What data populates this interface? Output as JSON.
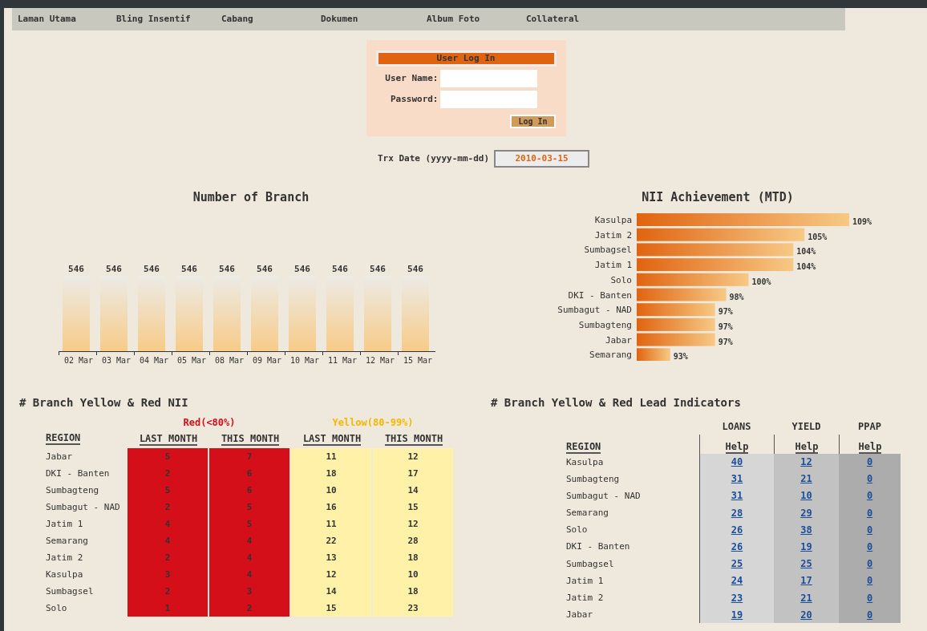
{
  "nav": [
    {
      "label": "Laman Utama"
    },
    {
      "label": "Bling Insentif"
    },
    {
      "label": "Cabang"
    },
    {
      "label": "Dokumen"
    },
    {
      "label": "Album Foto"
    },
    {
      "label": "Collateral"
    }
  ],
  "login": {
    "title": "User Log In",
    "fields": [
      {
        "label": "User Name:"
      },
      {
        "label": "Password:"
      }
    ],
    "button": "Log In"
  },
  "trx_date": {
    "label": "Trx Date (yyyy-mm-dd)",
    "value": "2010-03-15"
  },
  "branch_chart": {
    "chart_data": {
      "type": "bar",
      "title": "Number of Branch",
      "categories": [
        "02 Mar",
        "03 Mar",
        "04 Mar",
        "05 Mar",
        "08 Mar",
        "09 Mar",
        "10 Mar",
        "11 Mar",
        "12 Mar",
        "15 Mar"
      ],
      "values": [
        546,
        546,
        546,
        546,
        546,
        546,
        546,
        546,
        546,
        546
      ],
      "data_labels": true
    }
  },
  "nii_chart": {
    "chart_data": {
      "type": "bar",
      "orientation": "horizontal",
      "title": "NII Achievement (MTD)",
      "categories": [
        "Kasulpa",
        "Jatim 2",
        "Sumbagsel",
        "Jatim 1",
        "Solo",
        "DKI - Banten",
        "Sumbagut - NAD",
        "Sumbagteng",
        "Jabar",
        "Semarang"
      ],
      "values": [
        109,
        105,
        104,
        104,
        100,
        98,
        97,
        97,
        97,
        93
      ],
      "value_labels": [
        "109%",
        "105%",
        "104%",
        "104%",
        "100%",
        "98%",
        "97%",
        "97%",
        "97%",
        "93%"
      ],
      "xlim": [
        90,
        109
      ]
    }
  },
  "nii_table": {
    "title": "# Branch Yellow & Red NII",
    "groups": [
      {
        "label": "Red(<80%)",
        "color": "#d40f19"
      },
      {
        "label": "Yellow(80-99%)",
        "color": "#fff2a8"
      }
    ],
    "columns": [
      "REGION",
      "LAST MONTH",
      "THIS MONTH",
      "LAST MONTH",
      "THIS MONTH"
    ],
    "rows": [
      [
        "Jabar",
        "5",
        "7",
        "11",
        "12"
      ],
      [
        "DKI - Banten",
        "2",
        "6",
        "18",
        "17"
      ],
      [
        "Sumbagteng",
        "5",
        "6",
        "10",
        "14"
      ],
      [
        "Sumbagut - NAD",
        "2",
        "5",
        "16",
        "15"
      ],
      [
        "Jatim 1",
        "4",
        "5",
        "11",
        "12"
      ],
      [
        "Semarang",
        "4",
        "4",
        "22",
        "28"
      ],
      [
        "Jatim 2",
        "2",
        "4",
        "13",
        "18"
      ],
      [
        "Kasulpa",
        "3",
        "4",
        "12",
        "10"
      ],
      [
        "Sumbagsel",
        "2",
        "3",
        "14",
        "18"
      ],
      [
        "Solo",
        "1",
        "2",
        "15",
        "23"
      ]
    ]
  },
  "lead_table": {
    "title": "# Branch Yellow & Red Lead Indicators",
    "groups": [
      "LOANS",
      "YIELD",
      "PPAP"
    ],
    "columns": [
      "REGION",
      "Help",
      "Help",
      "Help"
    ],
    "rows": [
      [
        "Kasulpa",
        "40",
        "12",
        "0"
      ],
      [
        "Sumbagteng",
        "31",
        "21",
        "0"
      ],
      [
        "Sumbagut - NAD",
        "31",
        "10",
        "0"
      ],
      [
        "Semarang",
        "28",
        "29",
        "0"
      ],
      [
        "Solo",
        "26",
        "38",
        "0"
      ],
      [
        "DKI - Banten",
        "26",
        "19",
        "0"
      ],
      [
        "Sumbagsel",
        "25",
        "25",
        "0"
      ],
      [
        "Jatim 1",
        "24",
        "17",
        "0"
      ],
      [
        "Jatim 2",
        "23",
        "21",
        "0"
      ],
      [
        "Jabar",
        "19",
        "20",
        "0"
      ]
    ]
  }
}
